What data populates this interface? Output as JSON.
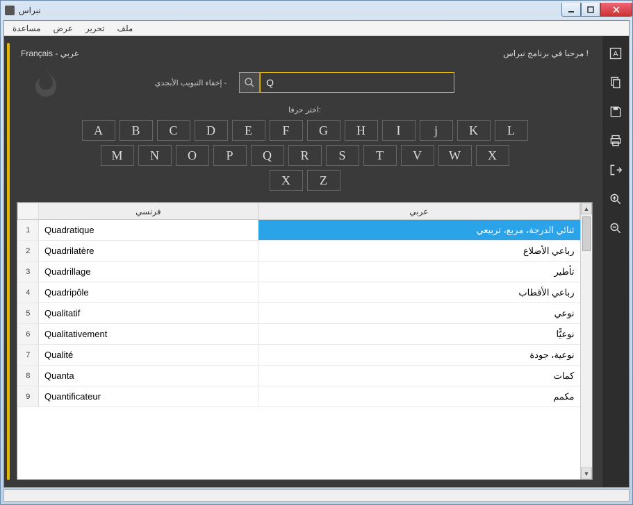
{
  "window": {
    "title": "نبراس"
  },
  "menubar": {
    "file": "ملف",
    "edit": "تحرير",
    "view": "عرض",
    "help": "مساعدة"
  },
  "header": {
    "welcome": "مرحبا في برنامج نبراس !",
    "lang_fr": "Français",
    "lang_sep": "-",
    "lang_ar": "عربي"
  },
  "search": {
    "value": "Q",
    "hide_alpha": "إخفاء التبويب الأبجدي -",
    "choose_letter": "اختر حرفا:"
  },
  "letters": {
    "row1": [
      "A",
      "B",
      "C",
      "D",
      "E",
      "F",
      "G",
      "H",
      "I",
      "j",
      "K",
      "L"
    ],
    "row2": [
      "M",
      "N",
      "O",
      "P",
      "Q",
      "R",
      "S",
      "T",
      "V",
      "W",
      "X"
    ],
    "row3": [
      "X",
      "Z"
    ]
  },
  "table": {
    "col_fr": "فرنسي",
    "col_ar": "عربي",
    "rows": [
      {
        "n": "1",
        "fr": "Quadratique",
        "ar": "ثنائي الدرجة، مربع، تربيعي",
        "selected": true
      },
      {
        "n": "2",
        "fr": "Quadrilatère",
        "ar": "رباعي الأضلاع"
      },
      {
        "n": "3",
        "fr": "Quadrillage",
        "ar": "تأطير"
      },
      {
        "n": "4",
        "fr": "Quadripôle",
        "ar": "رباعي الأقطاب"
      },
      {
        "n": "5",
        "fr": "Qualitatif",
        "ar": "نوعي"
      },
      {
        "n": "6",
        "fr": "Qualitativement",
        "ar": "نوعيًّا"
      },
      {
        "n": "7",
        "fr": "Qualité",
        "ar": "نوعية، جودة"
      },
      {
        "n": "8",
        "fr": "Quanta",
        "ar": "كمات"
      },
      {
        "n": "9",
        "fr": "Quantificateur",
        "ar": "مكمم"
      }
    ]
  },
  "statusbar": ""
}
